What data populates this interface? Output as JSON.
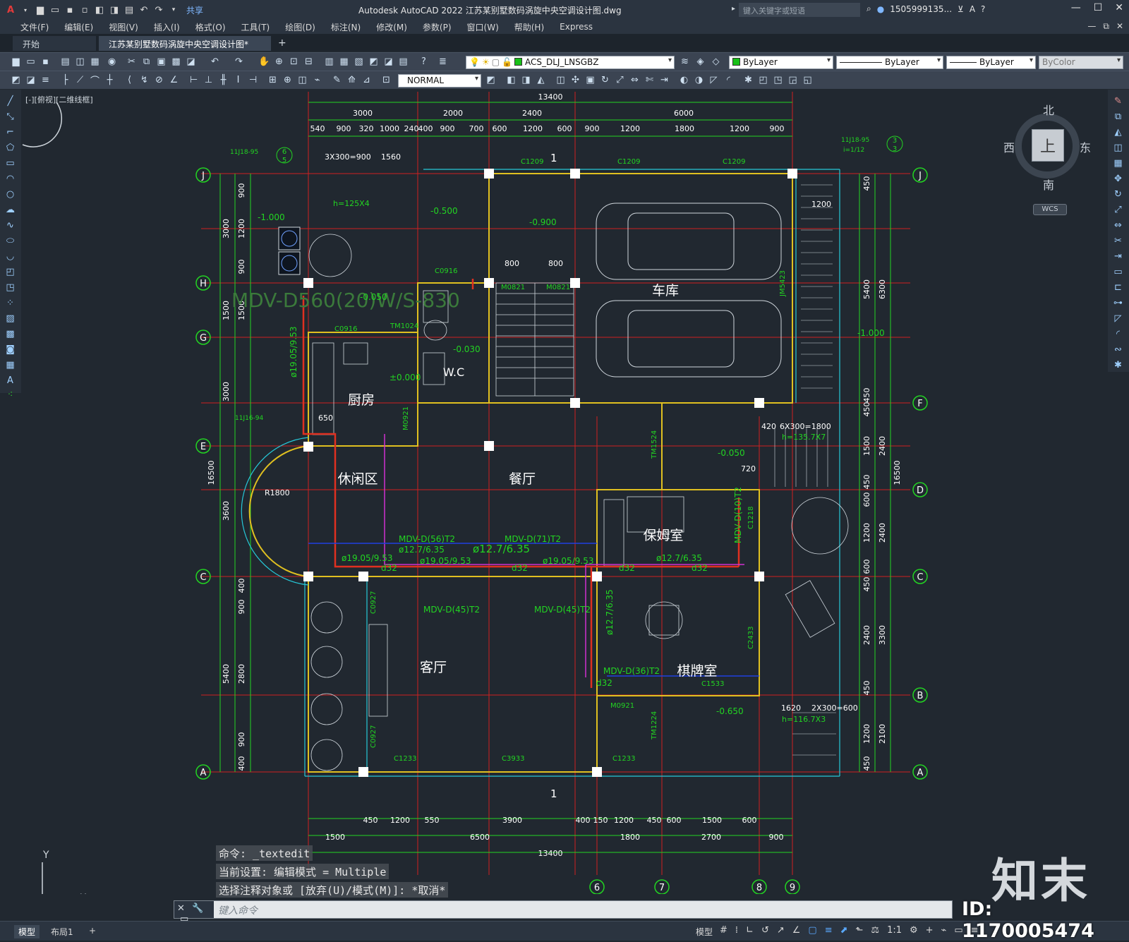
{
  "app": {
    "title": "Autodesk AutoCAD 2022    江苏某别墅数码涡旋中央空调设计图.dwg",
    "search_placeholder": "键入关键字或短语",
    "user": "1505999135...",
    "share": "共享"
  },
  "menu": [
    "文件(F)",
    "编辑(E)",
    "视图(V)",
    "插入(I)",
    "格式(O)",
    "工具(T)",
    "绘图(D)",
    "标注(N)",
    "修改(M)",
    "参数(P)",
    "窗口(W)",
    "帮助(H)",
    "Express"
  ],
  "tabs": {
    "start": "开始",
    "document": "江苏某别墅数码涡旋中央空调设计图*",
    "close": "×",
    "add": "+"
  },
  "toolbar": {
    "layer": "ACS_DLJ_LNSGBZ",
    "color": "ByLayer",
    "linetype": "ByLayer",
    "lineweight": "ByLayer",
    "plotstyle": "ByColor",
    "text_style": "NORMAL"
  },
  "viewport_label": "[-][俯视][二维线框]",
  "viewcube": {
    "north": "北",
    "south": "南",
    "east": "东",
    "west": "西",
    "face": "上",
    "wcs": "WCS"
  },
  "drawing": {
    "grid_letters": [
      "J",
      "H",
      "G",
      "E",
      "C",
      "A",
      "F",
      "D",
      "B"
    ],
    "grid_numbers": [
      "6",
      "7",
      "8",
      "9"
    ],
    "rooms": {
      "garage": "车库",
      "kitchen": "厨房",
      "wc": "W.C",
      "leisure": "休闲区",
      "dining": "餐厅",
      "maid_room": "保姆室",
      "living": "客厅",
      "chess_room": "棋牌室"
    },
    "dims_top": [
      "13400",
      "3000",
      "2000",
      "2400",
      "6000",
      "540",
      "900",
      "320",
      "1000",
      "240",
      "400",
      "900",
      "700",
      "600",
      "1200",
      "600",
      "900",
      "1200",
      "1800",
      "1200",
      "900"
    ],
    "dims_bottom": [
      "450",
      "1200",
      "550",
      "3900",
      "400",
      "150",
      "1200",
      "450",
      "600",
      "1500",
      "600",
      "1500",
      "6500",
      "1800",
      "2700",
      "900",
      "13400"
    ],
    "dims_left": [
      "16500",
      "3000",
      "1500",
      "3000",
      "3600",
      "5400",
      "900",
      "1200",
      "900",
      "1500",
      "2800",
      "900",
      "400",
      "400",
      "900"
    ],
    "dims_right": [
      "450",
      "5400",
      "6300",
      "450",
      "450",
      "1500",
      "2400",
      "16500",
      "450",
      "600",
      "1200",
      "2400",
      "600",
      "450",
      "2400",
      "3300",
      "450",
      "1200",
      "2100",
      "450"
    ],
    "labels": {
      "outdoor_unit": "MDV-D560(20)W/S-830",
      "idu_1": "MDV-D(56)T2",
      "idu_2": "MDV-D(71)T2",
      "idu_3": "MDV-D(45)T2",
      "idu_4": "MDV-D(45)T2",
      "idu_5": "MDV-D(36)T2",
      "idu_6": "MDV-D(10)T2",
      "pipe_1": "ø19.05/9.53",
      "pipe_2": "ø12.7/6.35",
      "pipe_3": "ø19.05/9.53",
      "pipe_4": "ø12.7/6.35",
      "pipe_5": "ø19.05/9.53",
      "pipe_6": "ø12.7/6.35",
      "pipe_7": "ø12.7/6.35",
      "pipe_8": "ø19.05/9.53",
      "drain": "d32",
      "elev_1": "-1.000",
      "elev_2": "-0.500",
      "elev_3": "-0.900",
      "elev_4": "-0.050",
      "elev_5": "±0.000",
      "elev_6": "-0.030",
      "elev_7": "-1.000",
      "elev_8": "-0.050",
      "elev_9": "-0.650",
      "win_1": "C1209",
      "win_2": "C1209",
      "win_3": "C1209",
      "win_4": "C0916",
      "win_5": "C0916",
      "win_6": "C1233",
      "win_7": "C3933",
      "win_8": "C1233",
      "win_9": "C1533",
      "win_10": "C1218",
      "win_11": "C2433",
      "win_12": "C0927",
      "win_13": "C0927",
      "door_1": "M0821",
      "door_2": "M0821",
      "door_3": "M0921",
      "door_4": "M0921",
      "door_5": "TM1024",
      "door_6": "TM1524",
      "door_7": "TM1224",
      "door_8": "JM5423",
      "stair_1": "3X300=900",
      "stair_2": "1560",
      "stair_3": "6X300=1800",
      "stair_4": "2X300=600",
      "stair_5": "h=135.7X7",
      "stair_6": "h=116.7X3",
      "stair_7": "h=125X4",
      "radius": "R1800",
      "section": "1",
      "stair_dim_1": "800",
      "stair_dim_2": "800",
      "stair_dim_3": "1200",
      "stair_dim_4": "720",
      "stair_dim_5": "420",
      "stair_dim_6": "1620",
      "stair_dim_7": "650",
      "ref_1": "11J18-95",
      "ref_2": "11J18-95",
      "ref_3": "11J16-94",
      "ref_4": "i=1/12",
      "detail_1": "6",
      "detail_1b": "5",
      "detail_2": "3",
      "detail_2b": "3"
    }
  },
  "command": {
    "line1": "命令: _textedit",
    "line2": "当前设置: 编辑模式 = Multiple",
    "line3": "选择注释对象或 [放弃(U)/模式(M)]: *取消*",
    "placeholder": "键入命令"
  },
  "status": {
    "model_tab": "模型",
    "layout_tab": "布局1",
    "add": "+",
    "model_btn": "模型",
    "scale": "1:1"
  },
  "watermark": {
    "logo": "知末",
    "id": "ID: 1170005474"
  }
}
